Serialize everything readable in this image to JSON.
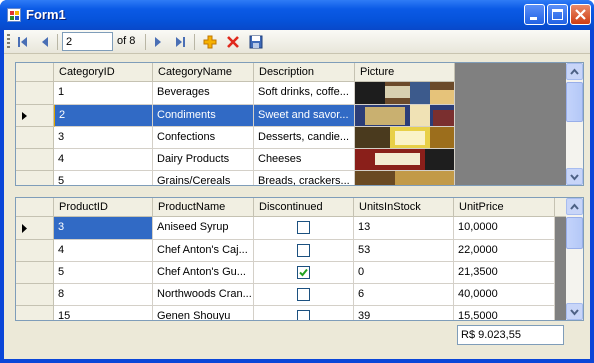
{
  "window": {
    "title": "Form1"
  },
  "navigator": {
    "position": "2",
    "count": "of 8"
  },
  "categories": {
    "columns": [
      "CategoryID",
      "CategoryName",
      "Description",
      "Picture"
    ],
    "rows": [
      {
        "id": "1",
        "name": "Beverages",
        "desc": "Soft drinks, coffe..."
      },
      {
        "id": "2",
        "name": "Condiments",
        "desc": "Sweet and savor..."
      },
      {
        "id": "3",
        "name": "Confections",
        "desc": "Desserts, candie..."
      },
      {
        "id": "4",
        "name": "Dairy Products",
        "desc": "Cheeses"
      },
      {
        "id": "5",
        "name": "Grains/Cereals",
        "desc": "Breads, crackers..."
      }
    ]
  },
  "products": {
    "columns": [
      "ProductID",
      "ProductName",
      "Discontinued",
      "UnitsInStock",
      "UnitPrice"
    ],
    "rows": [
      {
        "id": "3",
        "name": "Aniseed Syrup",
        "disc": false,
        "stock": "13",
        "price": "10,0000"
      },
      {
        "id": "4",
        "name": "Chef Anton's Caj...",
        "disc": false,
        "stock": "53",
        "price": "22,0000"
      },
      {
        "id": "5",
        "name": "Chef Anton's Gu...",
        "disc": true,
        "stock": "0",
        "price": "21,3500"
      },
      {
        "id": "8",
        "name": "Northwoods Cran...",
        "disc": false,
        "stock": "6",
        "price": "40,0000"
      },
      {
        "id": "15",
        "name": "Genen Shouyu",
        "disc": false,
        "stock": "39",
        "price": "15,5000"
      }
    ]
  },
  "total": "R$ 9.023,55"
}
